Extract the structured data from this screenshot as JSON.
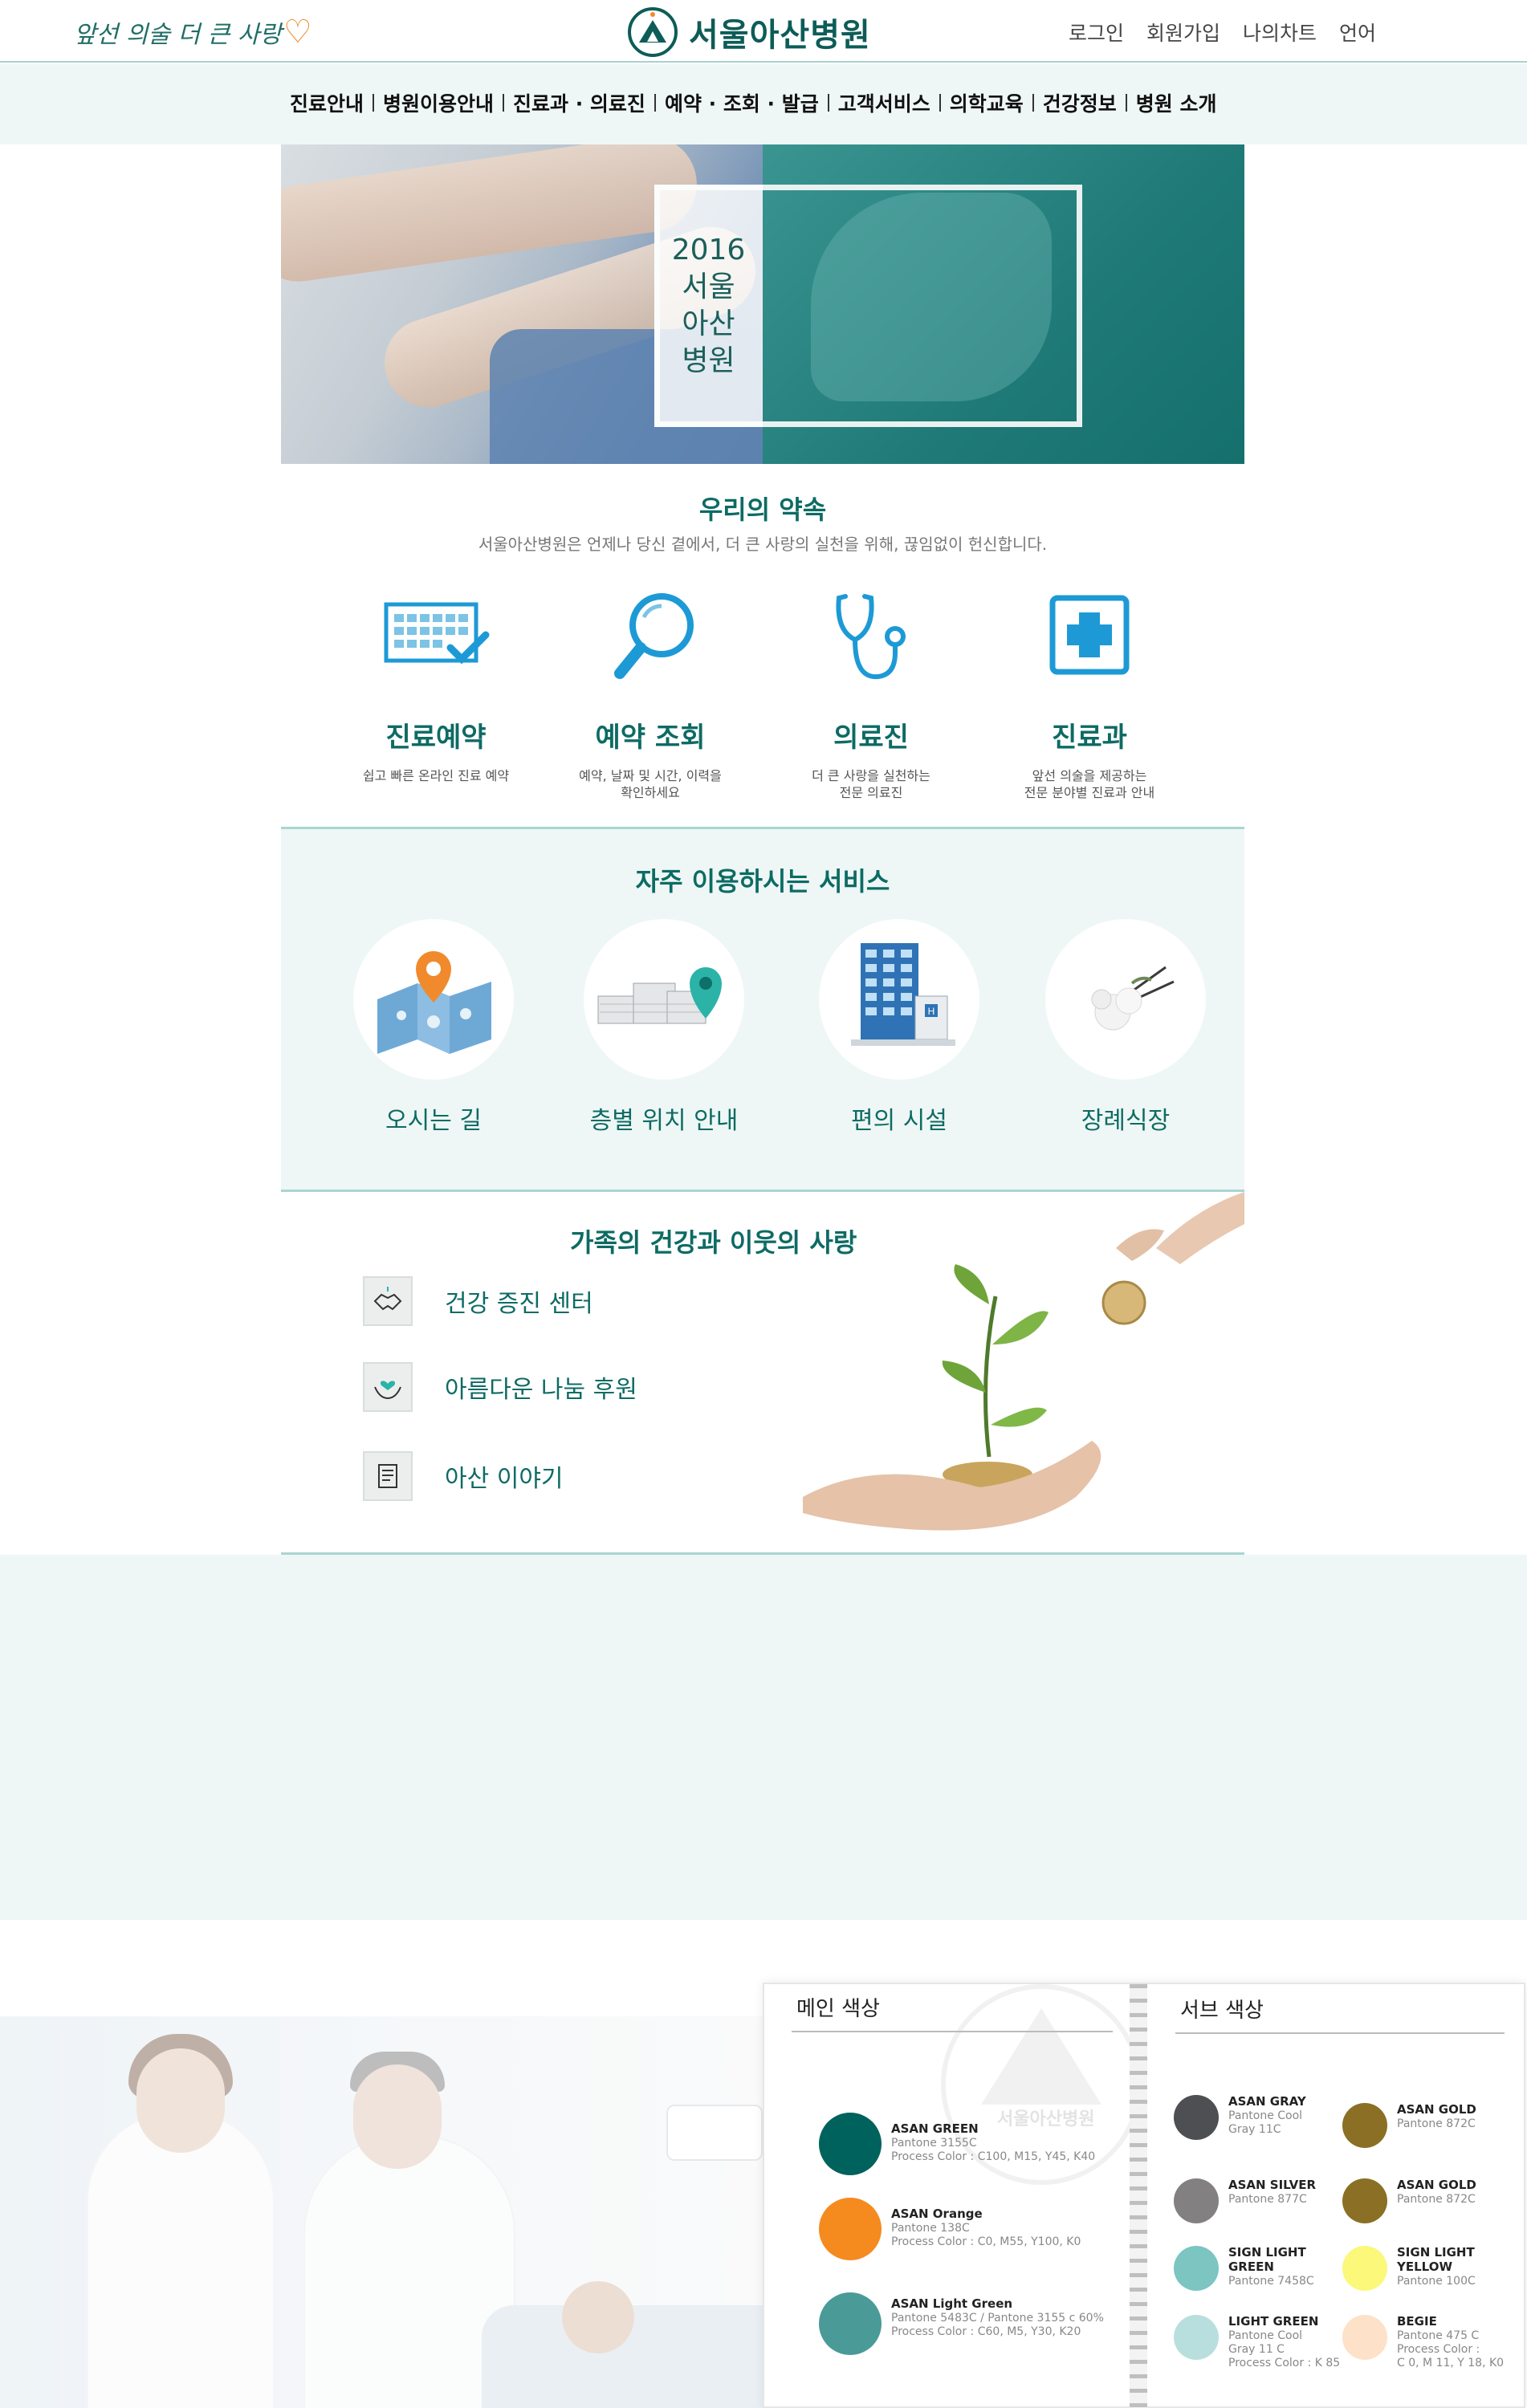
{
  "header": {
    "slogan": "앞선 의술 더 큰 사랑",
    "logo_text": "서울아산병원",
    "util": [
      "로그인",
      "회원가입",
      "나의차트",
      "언어"
    ]
  },
  "nav": {
    "items": [
      "진료안내",
      "병원이용안내",
      "진료과 · 의료진",
      "예약 · 조회 · 발급",
      "고객서비스",
      "의학교육",
      "건강정보",
      "병원 소개"
    ]
  },
  "hero": {
    "lines": [
      "2016",
      "서울",
      "아산",
      "병원"
    ]
  },
  "promise": {
    "title": "우리의 약속",
    "subtitle": "서울아산병원은 언제나 당신 곁에서, 더 큰 사랑의 실천을 위해, 끊임없이 헌신합니다.",
    "services": [
      {
        "name": "진료예약",
        "desc": "쉽고 빠른 온라인 진료 예약",
        "icon": "calendar-check-icon"
      },
      {
        "name": "예약 조회",
        "desc": "예약, 날짜 및 시간, 이력을\n확인하세요",
        "icon": "magnifier-icon"
      },
      {
        "name": "의료진",
        "desc": "더 큰 사랑을 실천하는\n전문 의료진",
        "icon": "stethoscope-icon"
      },
      {
        "name": "진료과",
        "desc": "앞선 의술을 제공하는\n전문 분야별 진료과 안내",
        "icon": "medical-cross-icon"
      }
    ]
  },
  "frequent": {
    "title": "자주 이용하시는 서비스",
    "items": [
      {
        "label": "오시는 길",
        "icon": "map-pin-icon"
      },
      {
        "label": "층별 위치 안내",
        "icon": "building-location-icon"
      },
      {
        "label": "편의 시설",
        "icon": "hospital-building-icon"
      },
      {
        "label": "장례식장",
        "icon": "flower-icon"
      }
    ]
  },
  "family": {
    "title": "가족의 건강과 이웃의 사랑",
    "links": [
      {
        "label": "건강 증진 센터",
        "icon": "handshake-icon"
      },
      {
        "label": "아름다운 나눔 후원",
        "icon": "heart-hands-icon"
      },
      {
        "label": "아산 이야기",
        "icon": "document-icon"
      }
    ]
  },
  "colorbook": {
    "main_title": "메인 색상",
    "sub_title": "서브 색상",
    "watermark": "서울아산병원",
    "main": [
      {
        "name": "ASAN GREEN",
        "lines": [
          "Pantone 3155C",
          "Process Color : C100, M15, Y45, K40"
        ],
        "hex": "#00625c"
      },
      {
        "name": "ASAN Orange",
        "lines": [
          "Pantone 138C",
          "Process Color : C0, M55, Y100, K0"
        ],
        "hex": "#f58a1f"
      },
      {
        "name": "ASAN Light Green",
        "lines": [
          "Pantone 5483C / Pantone 3155 c 60%",
          "Process Color : C60, M5, Y30, K20"
        ],
        "hex": "#4a9a98"
      }
    ],
    "sub_left": [
      {
        "name": "ASAN GRAY",
        "lines": [
          "Pantone Cool",
          "Gray 11C"
        ],
        "hex": "#4d4f53"
      },
      {
        "name": "ASAN SILVER",
        "lines": [
          "Pantone 877C"
        ],
        "hex": "#838081"
      },
      {
        "name": "SIGN LIGHT GREEN",
        "lines": [
          "Pantone 7458C"
        ],
        "hex": "#7cc5c1"
      },
      {
        "name": "LIGHT GREEN",
        "lines": [
          "Pantone Cool",
          "Gray 11 C",
          "Process Color : K 85"
        ],
        "hex": "#b8dfdd"
      }
    ],
    "sub_right": [
      {
        "name": "ASAN GOLD",
        "lines": [
          "Pantone 872C"
        ],
        "hex": "#8a6f25"
      },
      {
        "name": "ASAN GOLD",
        "lines": [
          "Pantone 872C"
        ],
        "hex": "#8a6f25"
      },
      {
        "name": "SIGN LIGHT YELLOW",
        "lines": [
          "Pantone 100C"
        ],
        "hex": "#fbf87a"
      },
      {
        "name": "BEGIE",
        "lines": [
          "Pantone 475 C",
          "Process Color :",
          "C 0, M 11, Y 18, K0"
        ],
        "hex": "#fde1c8"
      }
    ]
  }
}
